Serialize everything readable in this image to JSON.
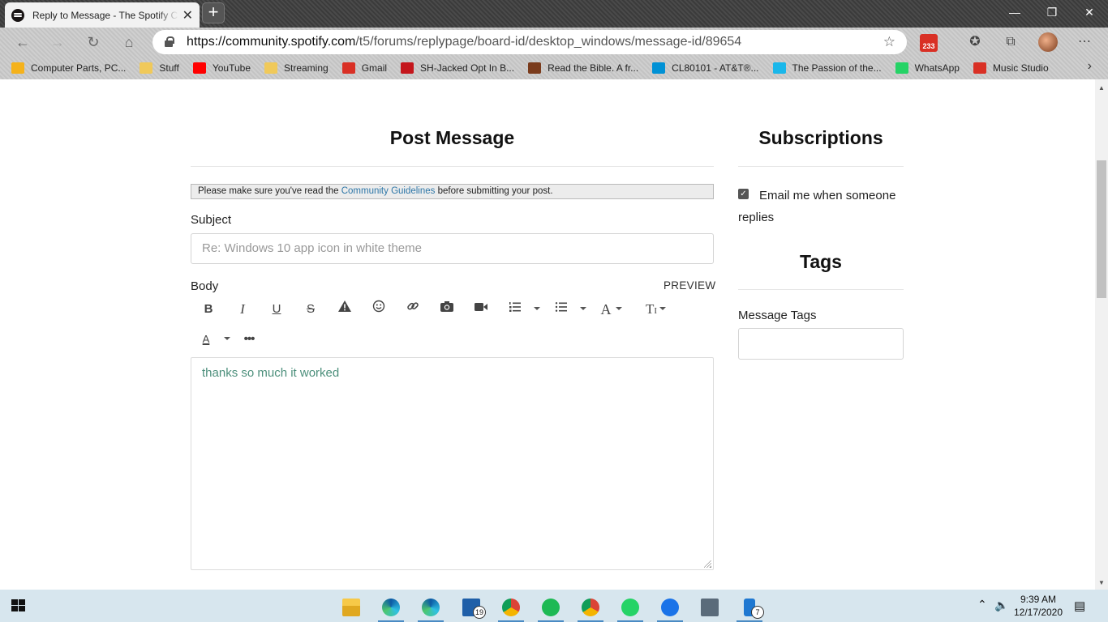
{
  "browser": {
    "tab_title": "Reply to Message - The Spotify Community",
    "tab_close": "✕",
    "new_tab": "+",
    "url_host": "https://community.spotify.com",
    "url_path": "/t5/forums/replypage/board-id/desktop_windows/message-id/89654",
    "mail_count": "233",
    "bookmarks": [
      {
        "label": "Computer Parts, PC...",
        "color": "#f5b21b"
      },
      {
        "label": "Stuff",
        "color": "#f0c95a"
      },
      {
        "label": "YouTube",
        "color": "#ff0000"
      },
      {
        "label": "Streaming",
        "color": "#f0c95a"
      },
      {
        "label": "Gmail",
        "color": "#d93025"
      },
      {
        "label": "SH-Jacked Opt In B...",
        "color": "#c4161c"
      },
      {
        "label": "Read the Bible. A fr...",
        "color": "#7a3b1c"
      },
      {
        "label": "CL80101 - AT&T®...",
        "color": "#0091d5"
      },
      {
        "label": "The Passion of the...",
        "color": "#1ab7ea"
      },
      {
        "label": "WhatsApp",
        "color": "#25d366"
      },
      {
        "label": "Music Studio",
        "color": "#d93025"
      }
    ],
    "bookmarks_more": "›"
  },
  "post": {
    "heading": "Post Message",
    "notice_prefix": "Please make sure you've read the ",
    "notice_link": "Community Guidelines",
    "notice_suffix": " before submitting your post.",
    "subject_label": "Subject",
    "subject_placeholder": "Re: Windows 10 app icon in white theme",
    "body_label": "Body",
    "preview_label": "PREVIEW",
    "body_text": "thanks so much it worked"
  },
  "subscriptions": {
    "heading": "Subscriptions",
    "email_label": "Email me when someone replies",
    "email_checked": true
  },
  "tags": {
    "heading": "Tags",
    "message_tags_label": "Message Tags",
    "message_tags_value": ""
  },
  "taskbar": {
    "mail_badge": "19",
    "phone_badge": "7",
    "time": "9:39 AM",
    "date": "12/17/2020"
  }
}
